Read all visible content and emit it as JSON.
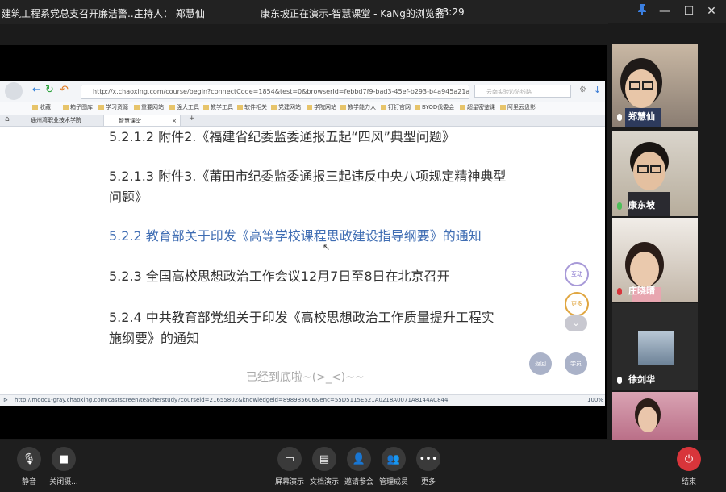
{
  "titlebar": {
    "meeting_title": "建筑工程系党总支召开廉洁警...",
    "host": "主持人： 郑慧仙",
    "presenting": "康东坡正在演示-智慧课堂 - KaNg的浏览器",
    "time": "23:29"
  },
  "browser": {
    "url": "http://x.chaoxing.com/course/begin?connectCode=1854&test=0&browserId=febbd7f9-bad3-45ef-b293-b4a945a21a",
    "search_placeholder": "云南实验边防线路",
    "bookmarks": [
      "收藏",
      "箱子图库",
      "学习资源",
      "重要网站",
      "强大工具",
      "教学工具",
      "软件相关",
      "党建网站",
      "学院网站",
      "教学能力大",
      "钉钉官网",
      "BYOD伐委会",
      "超星密鉴课",
      "阿里云盘影"
    ],
    "tabs": [
      "通州湾职业技术学院",
      "智慧课堂"
    ],
    "status_url": "http://mooc1-gray.chaoxing.com/castscreen/teacherstudy?courseid=21655802&knowledgeid=898985606&enc=55D5115E521A0218A0071A8144AC844",
    "zoom": "100%"
  },
  "content": {
    "items": [
      "5.2.1.2 附件2.《福建省纪委监委通报五起“四风”典型问题》",
      "5.2.1.3 附件3.《莆田市纪委监委通报三起违反中央八项规定精神典型",
      "问题》",
      "5.2.2 教育部关于印发《高等学校课程思政建设指导纲要》的通知",
      "5.2.3 全国高校思想政治工作会议12月7日至8日在北京召开",
      "5.2.4 中共教育部党组关于印发《高校思想政治工作质量提升工程实",
      "施纲要》的通知"
    ],
    "bottom_note": "已经到底啦~(>_<)~~",
    "fab_interact": "互动",
    "fab_more": "更多",
    "fab_back": "返回",
    "fab_student": "学员"
  },
  "participants": [
    {
      "name": "郑慧仙",
      "mic": "on"
    },
    {
      "name": "康东坡",
      "mic": "on"
    },
    {
      "name": "庄晓晴",
      "mic": "muted"
    },
    {
      "name": "徐剑华",
      "mic": "on"
    },
    {
      "name": "",
      "mic": "on"
    }
  ],
  "toolbar": {
    "mute": "静音",
    "camera_off": "关闭摄...",
    "screen_share": "屏幕演示",
    "doc_share": "文档演示",
    "invite": "邀请参会",
    "manage": "管理成员",
    "more": "更多",
    "end": "结束"
  },
  "colors": {
    "accent_link": "#3f6db3",
    "end_button": "#d8353b",
    "mic_on": "#4fbf5a",
    "mic_muted": "#d8353b"
  }
}
